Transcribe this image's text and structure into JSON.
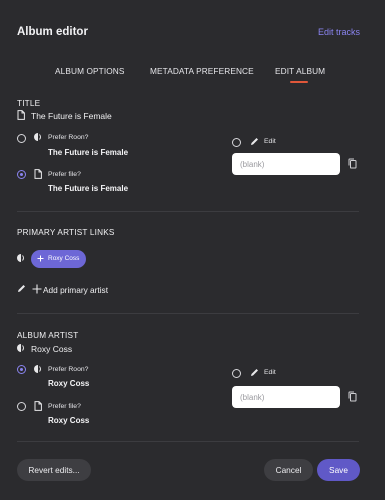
{
  "header": {
    "title": "Album editor",
    "edit_tracks": "Edit tracks"
  },
  "tabs": [
    {
      "label": "ALBUM OPTIONS",
      "active": false
    },
    {
      "label": "METADATA PREFERENCE",
      "active": false
    },
    {
      "label": "EDIT ALBUM",
      "active": true
    }
  ],
  "title_section": {
    "label": "TITLE",
    "current_value": "The Future is Female",
    "options": [
      {
        "label": "Prefer Roon?",
        "value": "The Future is Female",
        "selected": false,
        "icon": "roon-icon"
      },
      {
        "label": "Prefer file?",
        "value": "The Future is Female",
        "selected": true,
        "icon": "file-icon"
      }
    ],
    "edit_label": "Edit",
    "edit_placeholder": "(blank)"
  },
  "primary_artist_links": {
    "label": "PRIMARY ARTIST LINKS",
    "artists": [
      "Roxy Coss"
    ],
    "add_label": "Add primary artist"
  },
  "album_artist_section": {
    "label": "ALBUM ARTIST",
    "current_value": "Roxy Coss",
    "options": [
      {
        "label": "Prefer Roon?",
        "value": "Roxy Coss",
        "selected": true,
        "icon": "roon-icon"
      },
      {
        "label": "Prefer file?",
        "value": "Roxy Coss",
        "selected": false,
        "icon": "file-icon"
      }
    ],
    "edit_label": "Edit",
    "edit_placeholder": "(blank)"
  },
  "footer": {
    "revert_label": "Revert edits...",
    "cancel_label": "Cancel",
    "save_label": "Save"
  },
  "colors": {
    "accent": "#6d67d6",
    "tab_underline": "#e0573a",
    "background": "#2b2b2e"
  }
}
